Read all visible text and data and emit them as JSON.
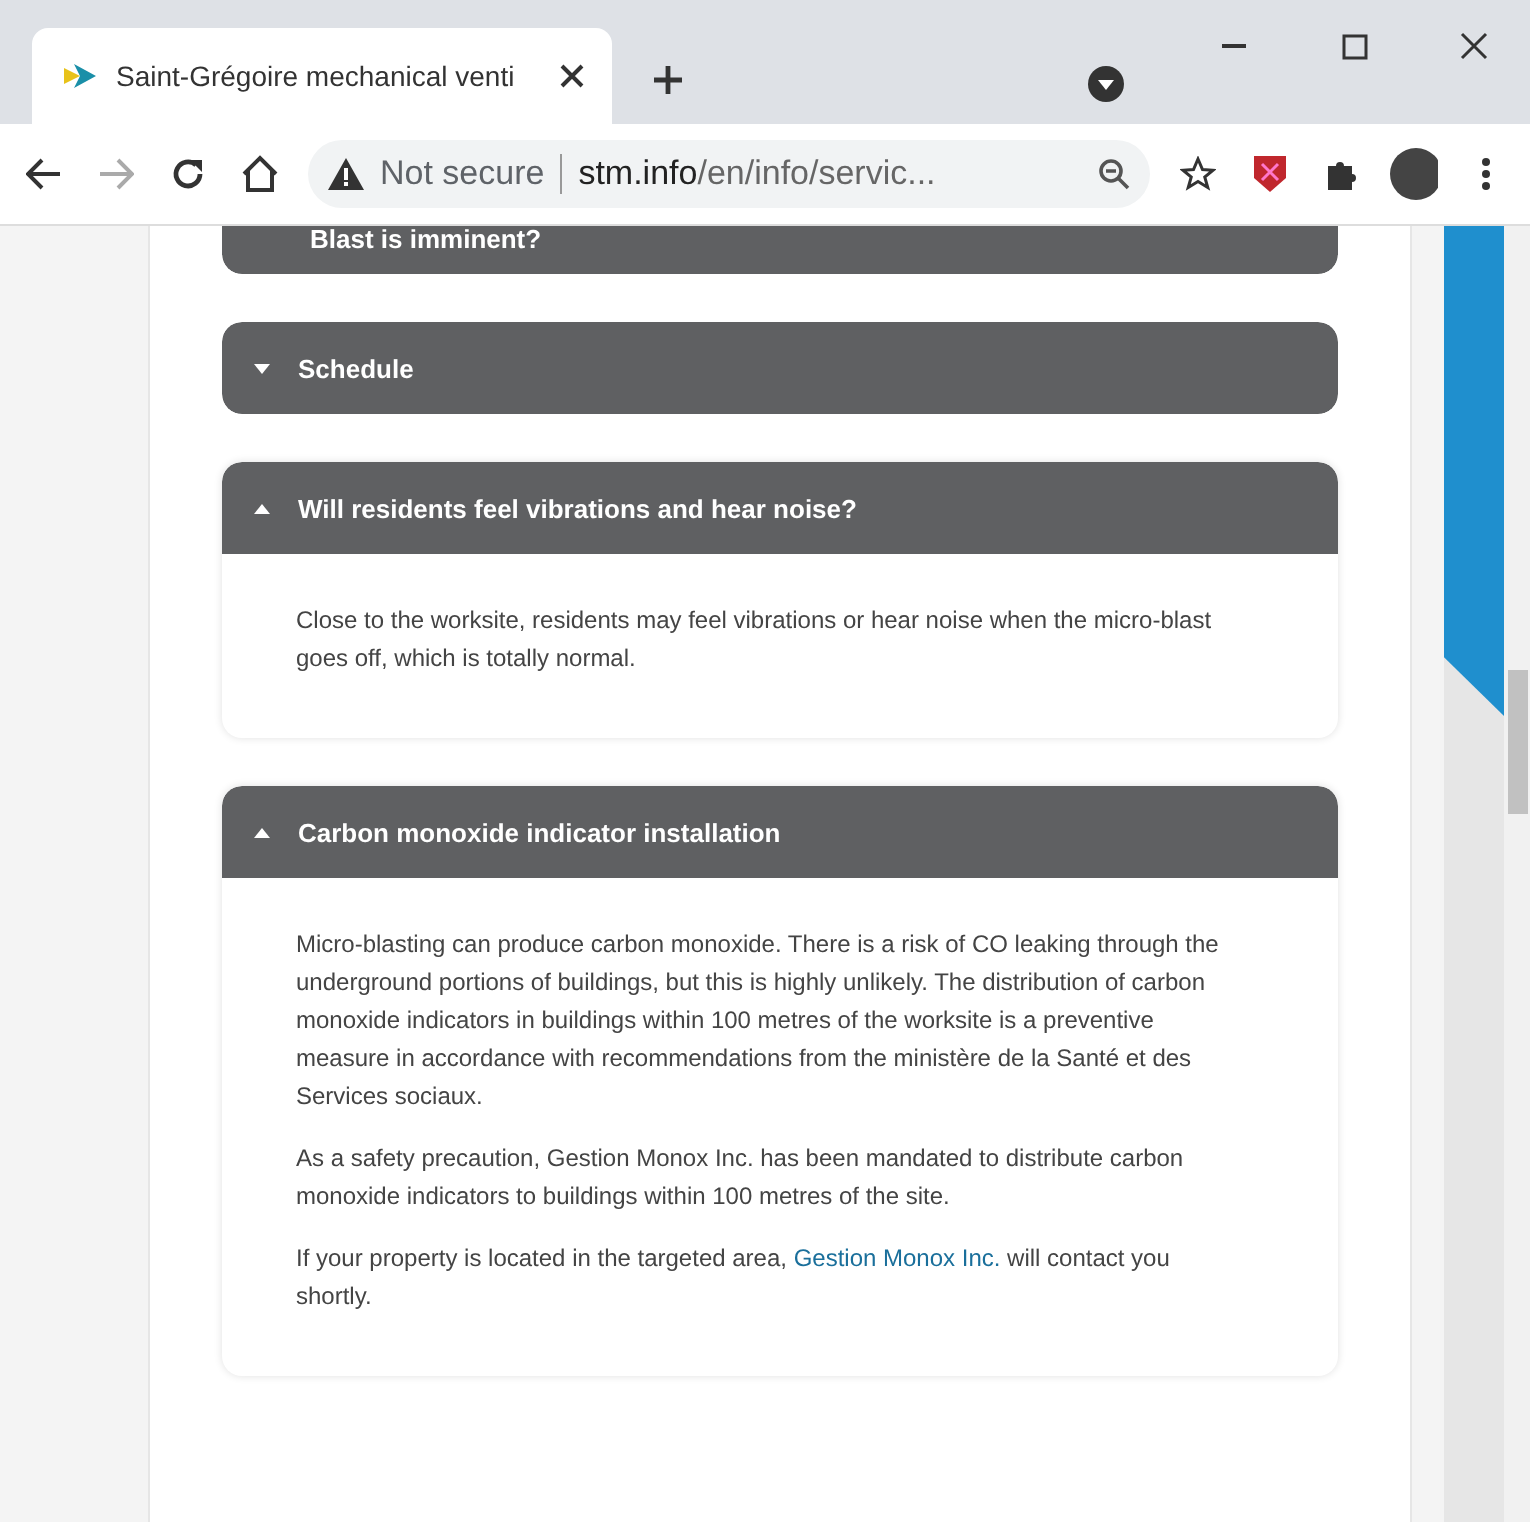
{
  "browser": {
    "tab": {
      "title": "Saint-Grégoire mechanical venti",
      "selected": true
    },
    "security": "Not secure",
    "url_host": "stm.info",
    "url_path": "/en/info/servic..."
  },
  "accordion": [
    {
      "title": "Blast is imminent?",
      "expanded": false
    },
    {
      "title": "Schedule",
      "expanded": false
    },
    {
      "title": "Will residents feel vibrations and hear noise?",
      "expanded": true,
      "paragraphs": [
        {
          "text": "Close to the worksite, residents may feel vibrations or hear noise when the micro-blast goes off, which is totally normal."
        }
      ]
    },
    {
      "title": "Carbon monoxide indicator installation",
      "expanded": true,
      "paragraphs": [
        {
          "text": "Micro-blasting can produce carbon monoxide. There is a risk of CO leaking through the underground portions of buildings, but this is highly unlikely. The distribution of carbon monoxide indicators in buildings within 100 metres of the worksite is a preventive measure in accordance with recommendations from the ministère de la Santé et des Services sociaux."
        },
        {
          "text": "As a safety precaution, Gestion Monox Inc. has been mandated to distribute carbon monoxide indicators to buildings within 100 metres of the site."
        },
        {
          "text": "If your property is located in the targeted area, ",
          "link": "Gestion Monox Inc.",
          "after": " will contact you shortly."
        }
      ]
    }
  ]
}
